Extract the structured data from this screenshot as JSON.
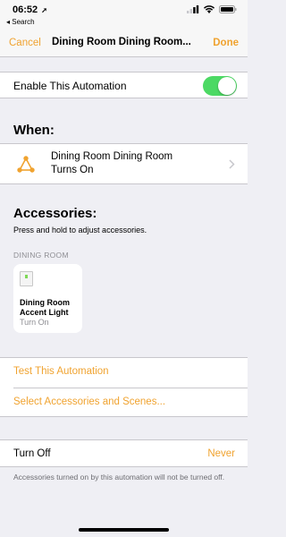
{
  "status_bar": {
    "time": "06:52",
    "location_glyph": "➚",
    "back_app": "◂ Search",
    "icons": [
      "cellular-signal-icon",
      "wifi-icon",
      "battery-icon"
    ]
  },
  "navbar": {
    "cancel_label": "Cancel",
    "title": "Dining Room Dining Room...",
    "done_label": "Done"
  },
  "enable": {
    "label": "Enable This Automation",
    "on": true
  },
  "when": {
    "heading": "When:",
    "trigger_line1": "Dining Room Dining Room",
    "trigger_line2": "Turns On"
  },
  "accessories": {
    "heading": "Accessories:",
    "subtitle": "Press and hold to adjust accessories.",
    "room": "DINING ROOM",
    "tile": {
      "name_line1": "Dining Room",
      "name_line2": "Accent Light",
      "state": "Turn On"
    }
  },
  "actions": {
    "test": "Test This Automation",
    "select": "Select Accessories and Scenes..."
  },
  "turn_off": {
    "label": "Turn Off",
    "value": "Never",
    "footer": "Accessories turned on by this automation will not be turned off."
  },
  "colors": {
    "accent": "#f0a330",
    "toggle_on": "#4cd964",
    "background": "#efeff4"
  }
}
